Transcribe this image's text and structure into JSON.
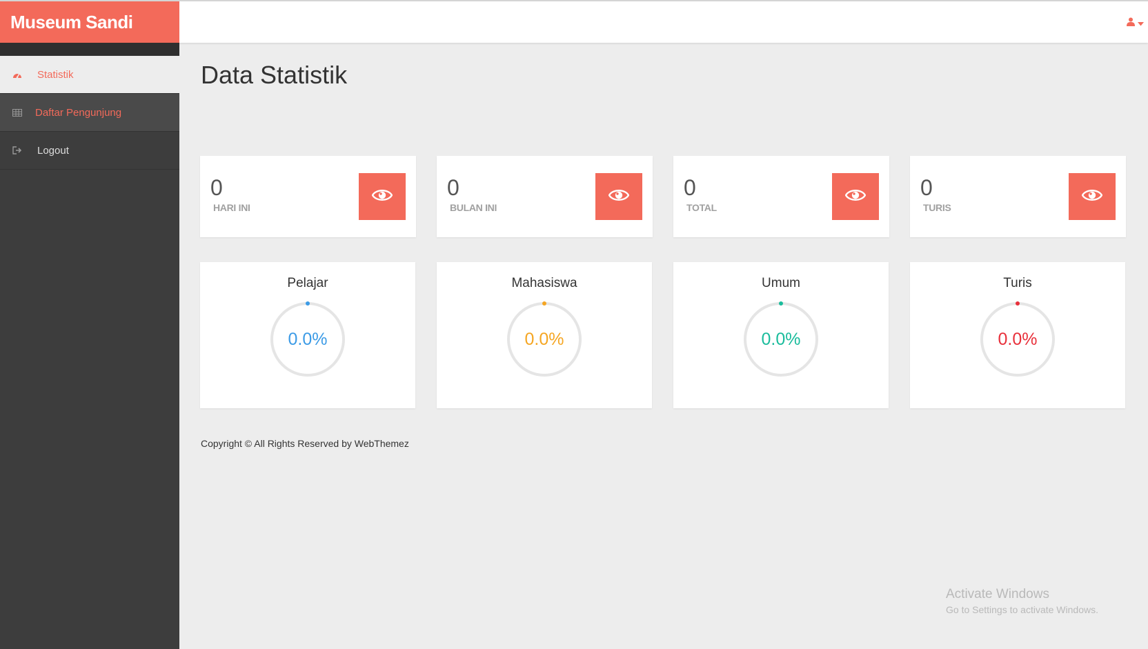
{
  "brand": "Museum Sandi",
  "header": {
    "user_icon": "user-icon",
    "caret_icon": "caret-down-icon"
  },
  "sidebar": {
    "items": [
      {
        "label": "Statistik",
        "icon": "dashboard-icon"
      },
      {
        "label": "Daftar Pengunjung",
        "icon": "table-icon"
      },
      {
        "label": "Logout",
        "icon": "sign-out-icon"
      }
    ]
  },
  "main": {
    "title": "Data Statistik",
    "stats": [
      {
        "value": "0",
        "label": "HARI INI",
        "icon": "eye-icon"
      },
      {
        "value": "0",
        "label": "BULAN INI",
        "icon": "eye-icon"
      },
      {
        "value": "0",
        "label": "TOTAL",
        "icon": "eye-icon"
      },
      {
        "value": "0",
        "label": "TURIS",
        "icon": "eye-icon"
      }
    ],
    "pies": [
      {
        "title": "Pelajar",
        "percent": "0.0%",
        "value": 0,
        "color": "#3c9be6"
      },
      {
        "title": "Mahasiswa",
        "percent": "0.0%",
        "value": 0,
        "color": "#f5a623"
      },
      {
        "title": "Umum",
        "percent": "0.0%",
        "value": 0,
        "color": "#1abc9c"
      },
      {
        "title": "Turis",
        "percent": "0.0%",
        "value": 0,
        "color": "#e8303b"
      }
    ],
    "footer": "Copyright © All Rights Reserved by WebThemez"
  },
  "watermark": {
    "line1": "Activate Windows",
    "line2": "Go to Settings to activate Windows."
  },
  "colors": {
    "accent": "#f36a5a",
    "sidebar": "#3d3d3d",
    "background": "#ededed"
  }
}
